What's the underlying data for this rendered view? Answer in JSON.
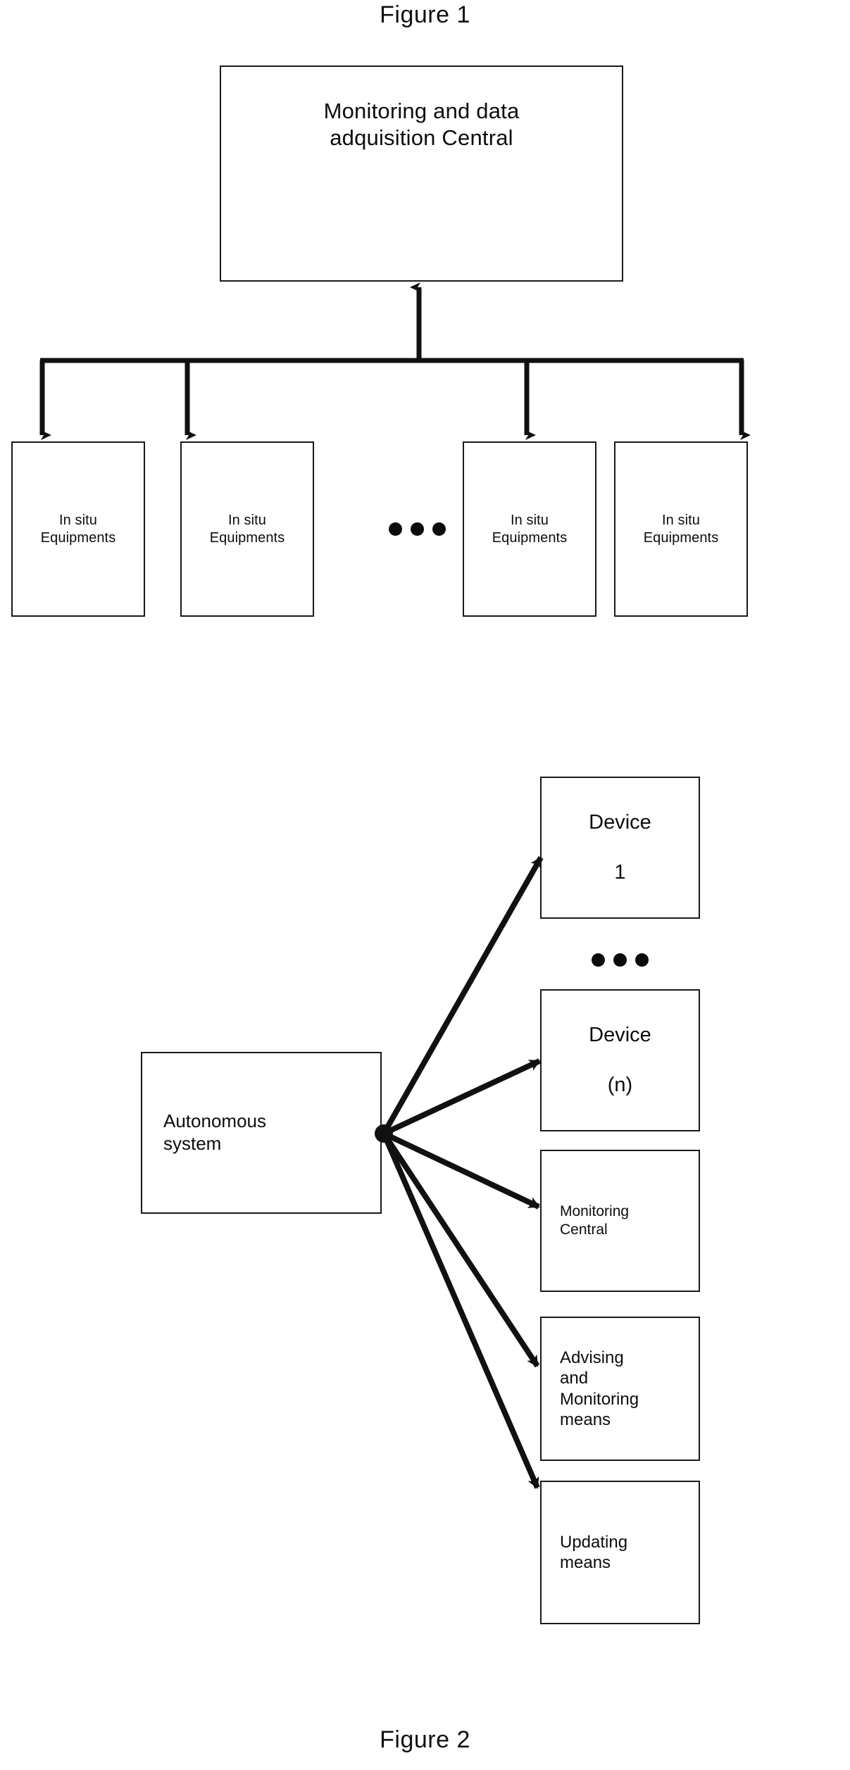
{
  "figure1": {
    "caption": "Figure 1",
    "central_box": {
      "label": "Monitoring and data\nadquisition Central"
    },
    "equipment_boxes": [
      {
        "label": "In situ\nEquipments"
      },
      {
        "label": "In situ\nEquipments"
      },
      {
        "label": "In situ\nEquipments"
      },
      {
        "label": "In situ\nEquipments"
      }
    ],
    "ellipsis": "● ● ●"
  },
  "figure2": {
    "caption": "Figure 2",
    "source_box": {
      "label": "Autonomous\nsystem"
    },
    "target_boxes": [
      {
        "label": "Device\n\n1"
      },
      {
        "label": "Device\n\n(n)"
      },
      {
        "label": "Monitoring\nCentral"
      },
      {
        "label": "Advising\nand\nMonitoring\nmeans"
      },
      {
        "label": "Updating\nmeans"
      }
    ],
    "ellipsis": "● ● ●"
  },
  "colors": {
    "ink": "#1a1a1a",
    "background": "#ffffff"
  }
}
